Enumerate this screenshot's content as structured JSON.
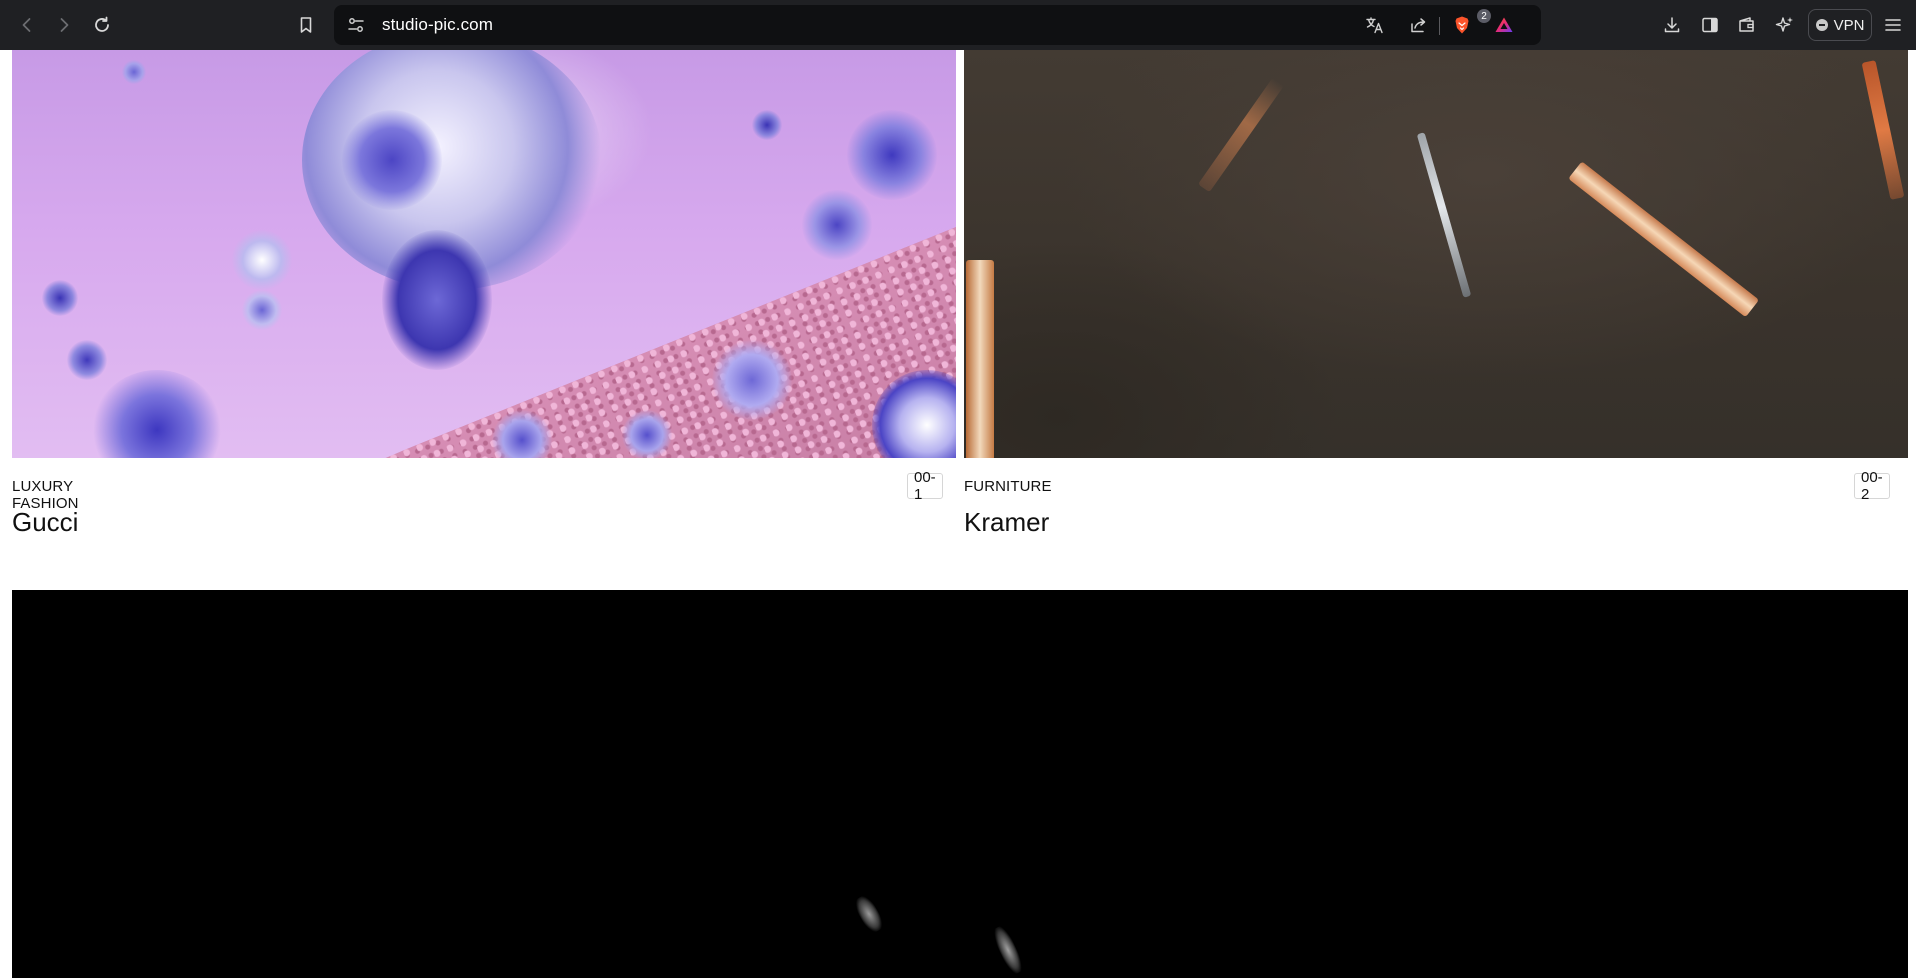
{
  "browser": {
    "url": "studio-pic.com",
    "shield_count": "2",
    "vpn_label": "VPN",
    "icons": [
      "back-icon",
      "forward-icon",
      "reload-icon",
      "bookmark-icon",
      "site-settings-icon",
      "translate-icon",
      "share-icon",
      "brave-shields-icon",
      "brave-rewards-icon",
      "downloads-icon",
      "sidebar-icon",
      "wallet-icon",
      "leo-ai-icon",
      "menu-icon"
    ]
  },
  "projects": [
    {
      "category": "LUXURY FASHION",
      "index": "00-1",
      "title": "Gucci"
    },
    {
      "category": "FURNITURE",
      "index": "00-2",
      "title": "Kramer"
    }
  ],
  "colors": {
    "chrome_bg": "#1f2023",
    "urlbar_bg": "#0f1012",
    "page_bg": "#ffffff",
    "text": "#111111",
    "brave_orange": "#fb542b"
  }
}
